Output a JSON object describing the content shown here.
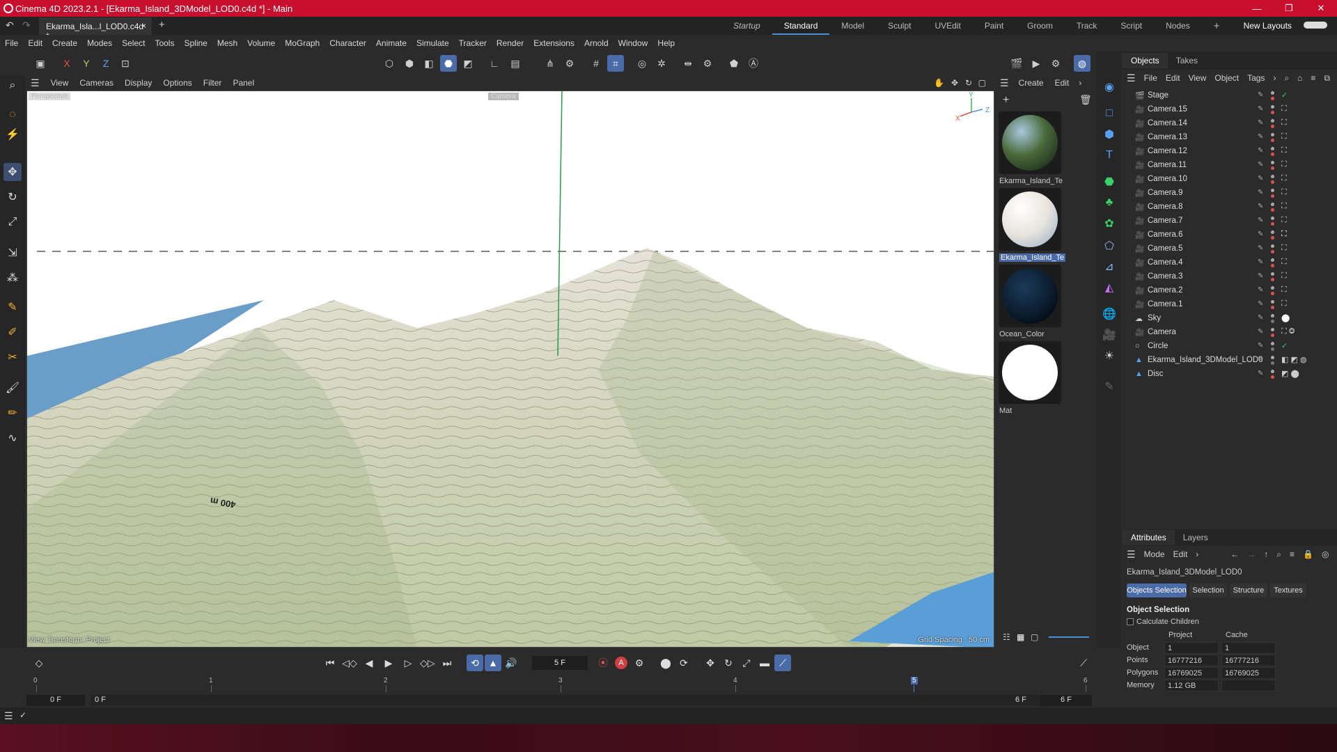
{
  "window": {
    "title": "Cinema 4D 2023.2.1 - [Ekarma_Island_3DModel_LOD0.c4d *] - Main",
    "minimize": "—",
    "restore": "❐",
    "close": "✕"
  },
  "doc_tab": {
    "label": "Ekarma_Isla...l_LOD0.c4d *",
    "close": "×",
    "add": "+"
  },
  "layouts": {
    "items": [
      "Startup",
      "Standard",
      "Model",
      "Sculpt",
      "UVEdit",
      "Paint",
      "Groom",
      "Track",
      "Script",
      "Nodes"
    ],
    "active": "Standard",
    "add": "+",
    "new_layouts": "New Layouts"
  },
  "menu": [
    "File",
    "Edit",
    "Create",
    "Modes",
    "Select",
    "Tools",
    "Spline",
    "Mesh",
    "Volume",
    "MoGraph",
    "Character",
    "Animate",
    "Simulate",
    "Tracker",
    "Render",
    "Extensions",
    "Arnold",
    "Window",
    "Help"
  ],
  "axis_toggles": {
    "x": "X",
    "y": "Y",
    "z": "Z"
  },
  "viewport": {
    "menu": [
      "View",
      "Cameras",
      "Display",
      "Options",
      "Filter",
      "Panel"
    ],
    "label_perspective": "Perspective",
    "label_camera": "Camera",
    "axis_x": "X",
    "axis_y": "Y",
    "axis_z": "Z",
    "footer_left": "View Transform: Project",
    "footer_right": "Grid Spacing : 50 cm",
    "terrain_label": "400 m"
  },
  "materials": {
    "menu": [
      "Create",
      "Edit"
    ],
    "items": [
      {
        "name": "Ekarma_Island_Te",
        "color": "#4a6a3a"
      },
      {
        "name": "Ekarma_Island_Te",
        "color": "#e8e4dc"
      },
      {
        "name": "Ocean_Color",
        "color": "#0a1a2a"
      },
      {
        "name": "Mat",
        "color": "#ffffff"
      }
    ]
  },
  "objects_panel": {
    "tabs": [
      "Objects",
      "Takes"
    ],
    "menu": [
      "File",
      "Edit",
      "View",
      "Object",
      "Tags"
    ],
    "rows": [
      "Stage",
      "Camera.15",
      "Camera.14",
      "Camera.13",
      "Camera.12",
      "Camera.11",
      "Camera.10",
      "Camera.9",
      "Camera.8",
      "Camera.7",
      "Camera.6",
      "Camera.5",
      "Camera.4",
      "Camera.3",
      "Camera.2",
      "Camera.1",
      "Sky",
      "Camera",
      "Circle",
      "Ekarma_Island_3DModel_LOD0",
      "Disc"
    ]
  },
  "attributes": {
    "tabs": [
      "Attributes",
      "Layers"
    ],
    "menu": [
      "Mode",
      "Edit"
    ],
    "object_name": "Ekarma_Island_3DModel_LOD0",
    "buttons": [
      "Objects Selection",
      "Selection",
      "Structure",
      "Textures"
    ],
    "section_title": "Object Selection",
    "calc_children": "Calculate Children",
    "col_project": "Project",
    "col_cache": "Cache",
    "rows": [
      {
        "label": "Object",
        "project": "1",
        "cache": "1"
      },
      {
        "label": "Points",
        "project": "16777216",
        "cache": "16777216"
      },
      {
        "label": "Polygons",
        "project": "16769025",
        "cache": "16769025"
      },
      {
        "label": "Memory",
        "project": "1.12 GB",
        "cache": ""
      }
    ]
  },
  "timeline": {
    "current_frame": "5 F",
    "ticks": [
      "0",
      "1",
      "2",
      "3",
      "4",
      "5",
      "6"
    ],
    "start": "0 F",
    "start2": "0 F",
    "end": "6 F",
    "end2": "6 F"
  }
}
